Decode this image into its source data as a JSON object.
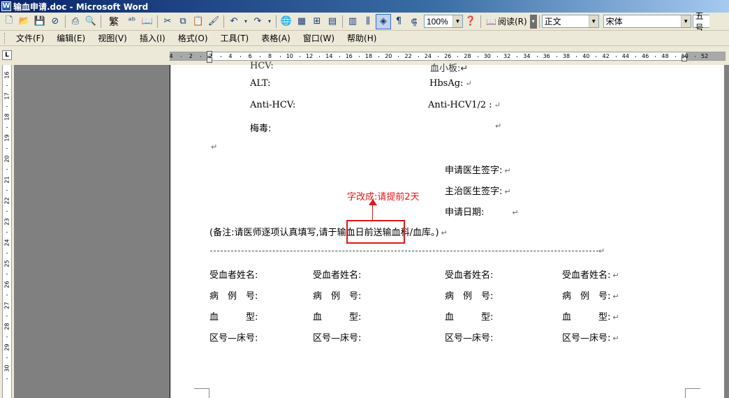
{
  "window": {
    "title": "输血申请.doc - Microsoft Word"
  },
  "toolbar": {
    "zoom": "100%",
    "read_label": "阅读(R)",
    "style": "正文",
    "font": "宋体",
    "size": "五号",
    "traditional_label": "繁"
  },
  "menu": {
    "items": [
      "文件(F)",
      "编辑(E)",
      "视图(V)",
      "插入(I)",
      "格式(O)",
      "工具(T)",
      "表格(A)",
      "窗口(W)",
      "帮助(H)"
    ]
  },
  "ruler": {
    "corner": "L",
    "ticks": [
      "4",
      "2",
      "2",
      "4",
      "6",
      "8",
      "10",
      "12",
      "14",
      "16",
      "18",
      "20",
      "22",
      "24",
      "26",
      "28",
      "30",
      "32",
      "34",
      "36",
      "38",
      "40",
      "42",
      "44",
      "46",
      "48",
      "50",
      "52"
    ],
    "vticks": [
      "16",
      "17",
      "18",
      "19",
      "20",
      "21",
      "22",
      "23",
      "24",
      "25",
      "26",
      "27",
      "28",
      "29",
      "30"
    ]
  },
  "document": {
    "tests": {
      "alt": "ALT:",
      "hbsag": "HbsAg:",
      "anti_hcv": "Anti-HCV:",
      "anti_hcv12": "Anti-HCV1/2 :",
      "syphilis": "梅毒:"
    },
    "signatures": {
      "applicant_doctor": "申请医生签字:",
      "attending_doctor": "主治医生签字:",
      "apply_date": "申请日期:"
    },
    "note": "(备注:请医师逐项认真填写,请于输血日前送输血科/血库。)",
    "callout": "字改成:请提前2天",
    "recipient": {
      "name": "受血者姓名:",
      "case_no": "病　例　号:",
      "blood_type": "血　　　型:",
      "ward_bed": "区号—床号:"
    },
    "para_mark": "↵"
  }
}
